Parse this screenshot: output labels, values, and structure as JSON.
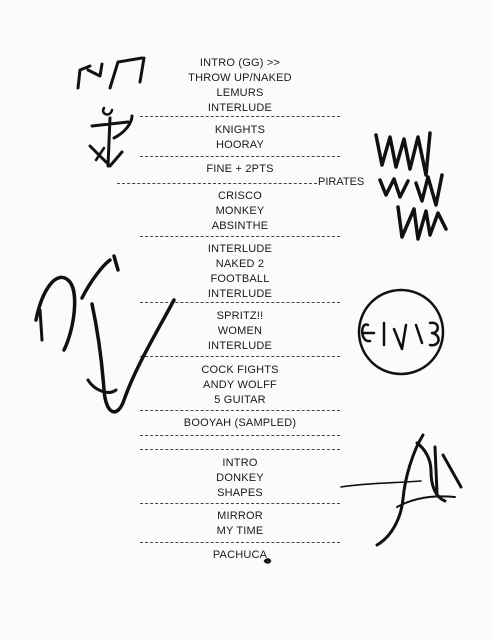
{
  "setlist": {
    "sections": [
      [
        "INTRO (GG) >>",
        "THROW UP/NAKED",
        "LEMURS",
        "INTERLUDE"
      ],
      [
        "KNIGHTS",
        "HOORAY"
      ],
      [
        "FINE + 2PTS"
      ],
      [
        "CRISCO",
        "MONKEY",
        "ABSINTHE"
      ],
      [
        "INTERLUDE",
        "NAKED 2",
        "FOOTBALL",
        "INTERLUDE"
      ],
      [
        "SPRITZ!!",
        "WOMEN",
        "INTERLUDE"
      ],
      [
        "COCK FIGHTS",
        "ANDY WOLFF",
        "5 GUITAR"
      ],
      [
        "BOOYAH (SAMPLED)"
      ],
      [],
      [
        "INTRO",
        "DONKEY",
        "SHAPES"
      ],
      [
        "MIRROR",
        "MY TIME"
      ],
      [
        "PACHUCA"
      ]
    ],
    "side_note": "PIRATES"
  },
  "signatures": {
    "color": "#111111",
    "items": [
      "signature-top-left",
      "signature-top-right",
      "signature-middle-left",
      "signature-circled-right",
      "signature-bottom-right"
    ]
  }
}
